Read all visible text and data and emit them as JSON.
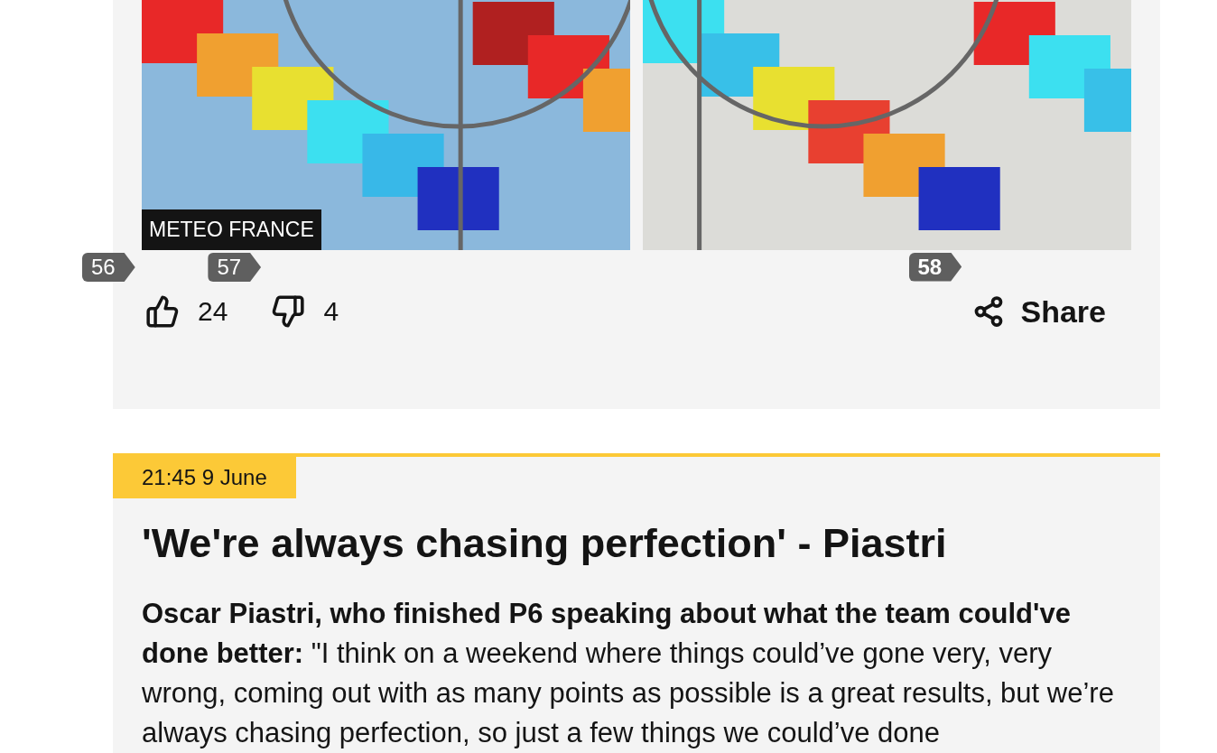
{
  "post_1": {
    "credit": "METEO FRANCE",
    "reactions": [
      {
        "kind": "like",
        "count": "24",
        "hint": "56"
      },
      {
        "kind": "dislike",
        "count": "4",
        "hint": "57"
      }
    ],
    "share": {
      "label": "Share",
      "hint": "58"
    }
  },
  "post_2": {
    "time": "21:45 9 June",
    "headline": "'We're always chasing perfection' - Piastri",
    "paragraph": "**Oscar Piastri, who finished P6 speaking about what the team could've done better:** \"I think on a weekend where things could’ve gone very, very wrong, coming out with as many points as possible is a great results, but we’re always chasing perfection, so just a few things we could’ve done"
  }
}
